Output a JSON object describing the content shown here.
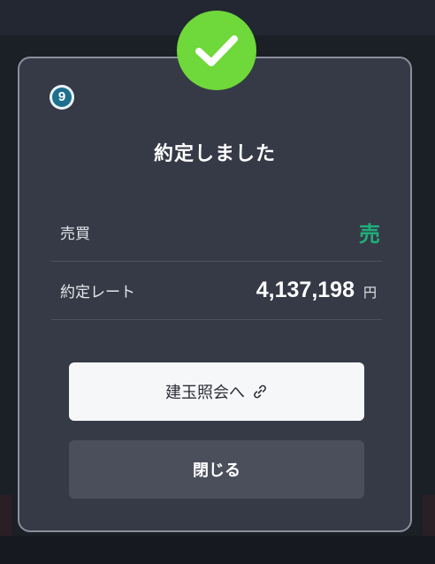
{
  "dialog": {
    "title": "約定しました",
    "step_number": "9",
    "success_icon": "checkmark-icon",
    "link_icon": "link-icon"
  },
  "details": {
    "side_label": "売買",
    "side_value": "売",
    "rate_label": "約定レート",
    "rate_value": "4,137,198",
    "rate_unit": "円"
  },
  "buttons": {
    "positions_label": "建玉照会へ",
    "close_label": "閉じる"
  },
  "colors": {
    "success": "#6fd83a",
    "sell": "#1fae7a",
    "dialog_bg": "#363a46"
  }
}
